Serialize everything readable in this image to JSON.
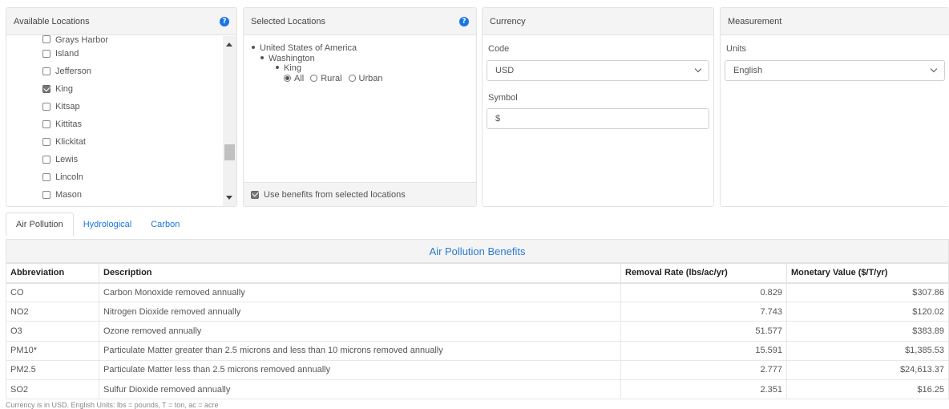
{
  "available": {
    "title": "Available Locations",
    "items": [
      {
        "label": "Grays Harbor",
        "checked": false
      },
      {
        "label": "Island",
        "checked": false
      },
      {
        "label": "Jefferson",
        "checked": false
      },
      {
        "label": "King",
        "checked": true
      },
      {
        "label": "Kitsap",
        "checked": false
      },
      {
        "label": "Kittitas",
        "checked": false
      },
      {
        "label": "Klickitat",
        "checked": false
      },
      {
        "label": "Lewis",
        "checked": false
      },
      {
        "label": "Lincoln",
        "checked": false
      },
      {
        "label": "Mason",
        "checked": false
      }
    ]
  },
  "selected": {
    "title": "Selected Locations",
    "country": "United States of America",
    "state": "Washington",
    "county": "King",
    "options": [
      "All",
      "Rural",
      "Urban"
    ],
    "option_selected": "All",
    "use_benefits_label": "Use benefits from selected locations",
    "use_benefits_checked": true
  },
  "currency": {
    "title": "Currency",
    "code_label": "Code",
    "code_value": "USD",
    "symbol_label": "Symbol",
    "symbol_value": "$"
  },
  "measurement": {
    "title": "Measurement",
    "units_label": "Units",
    "units_value": "English"
  },
  "tabs": [
    "Air Pollution",
    "Hydrological",
    "Carbon"
  ],
  "active_tab": "Air Pollution",
  "table": {
    "title": "Air Pollution Benefits",
    "headers": [
      "Abbreviation",
      "Description",
      "Removal Rate (lbs/ac/yr)",
      "Monetary Value ($/T/yr)"
    ],
    "rows": [
      [
        "CO",
        "Carbon Monoxide removed annually",
        "0.829",
        "$307.86"
      ],
      [
        "NO2",
        "Nitrogen Dioxide removed annually",
        "7.743",
        "$120.02"
      ],
      [
        "O3",
        "Ozone removed annually",
        "51.577",
        "$383.89"
      ],
      [
        "PM10*",
        "Particulate Matter greater than 2.5 microns and less than 10 microns removed annually",
        "15.591",
        "$1,385.53"
      ],
      [
        "PM2.5",
        "Particulate Matter less than 2.5 microns removed annually",
        "2.777",
        "$24,613.37"
      ],
      [
        "SO2",
        "Sulfur Dioxide removed annually",
        "2.351",
        "$16.25"
      ]
    ]
  },
  "footnote": "Currency is in USD. English Units: lbs = pounds, T = ton, ac = acre",
  "colors": {
    "accent": "#1a73e8",
    "title_blue": "#2b7bd6",
    "header_bg": "#f4f4f4"
  }
}
